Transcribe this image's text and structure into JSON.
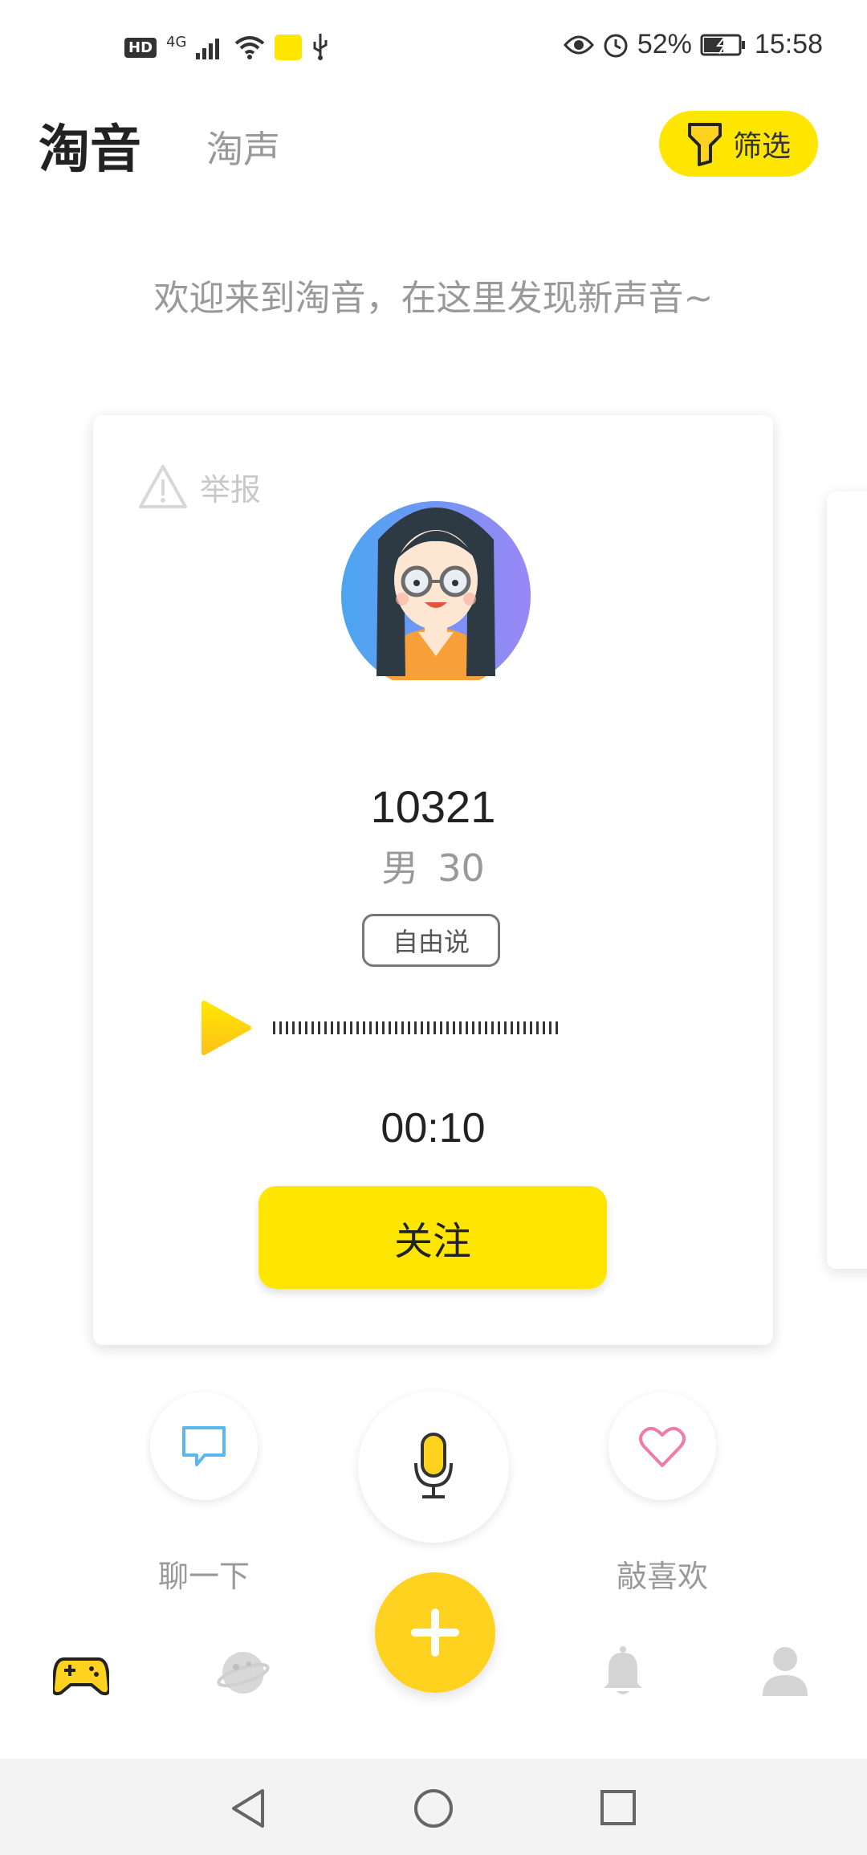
{
  "status_bar": {
    "hd": "HD",
    "network": "4G",
    "battery_percent": "52%",
    "time": "15:58"
  },
  "header": {
    "title": "淘音",
    "subtitle": "淘声",
    "filter_label": "筛选"
  },
  "welcome_text": "欢迎来到淘音，在这里发现新声音~",
  "card": {
    "report_label": "举报",
    "user_id": "10321",
    "gender": "男",
    "age": "30",
    "tag": "自由说",
    "duration": "00:10",
    "follow_label": "关注"
  },
  "actions": {
    "chat_label": "聊一下",
    "like_label": "敲喜欢"
  },
  "bottom_nav": {
    "icons": [
      "gamepad-icon",
      "planet-icon",
      "add-icon",
      "bell-icon",
      "user-icon"
    ]
  },
  "colors": {
    "accent": "#ffe600",
    "fab": "#ffd21f",
    "chat_blue": "#5ab8f0",
    "like_pink": "#f07aa8"
  }
}
